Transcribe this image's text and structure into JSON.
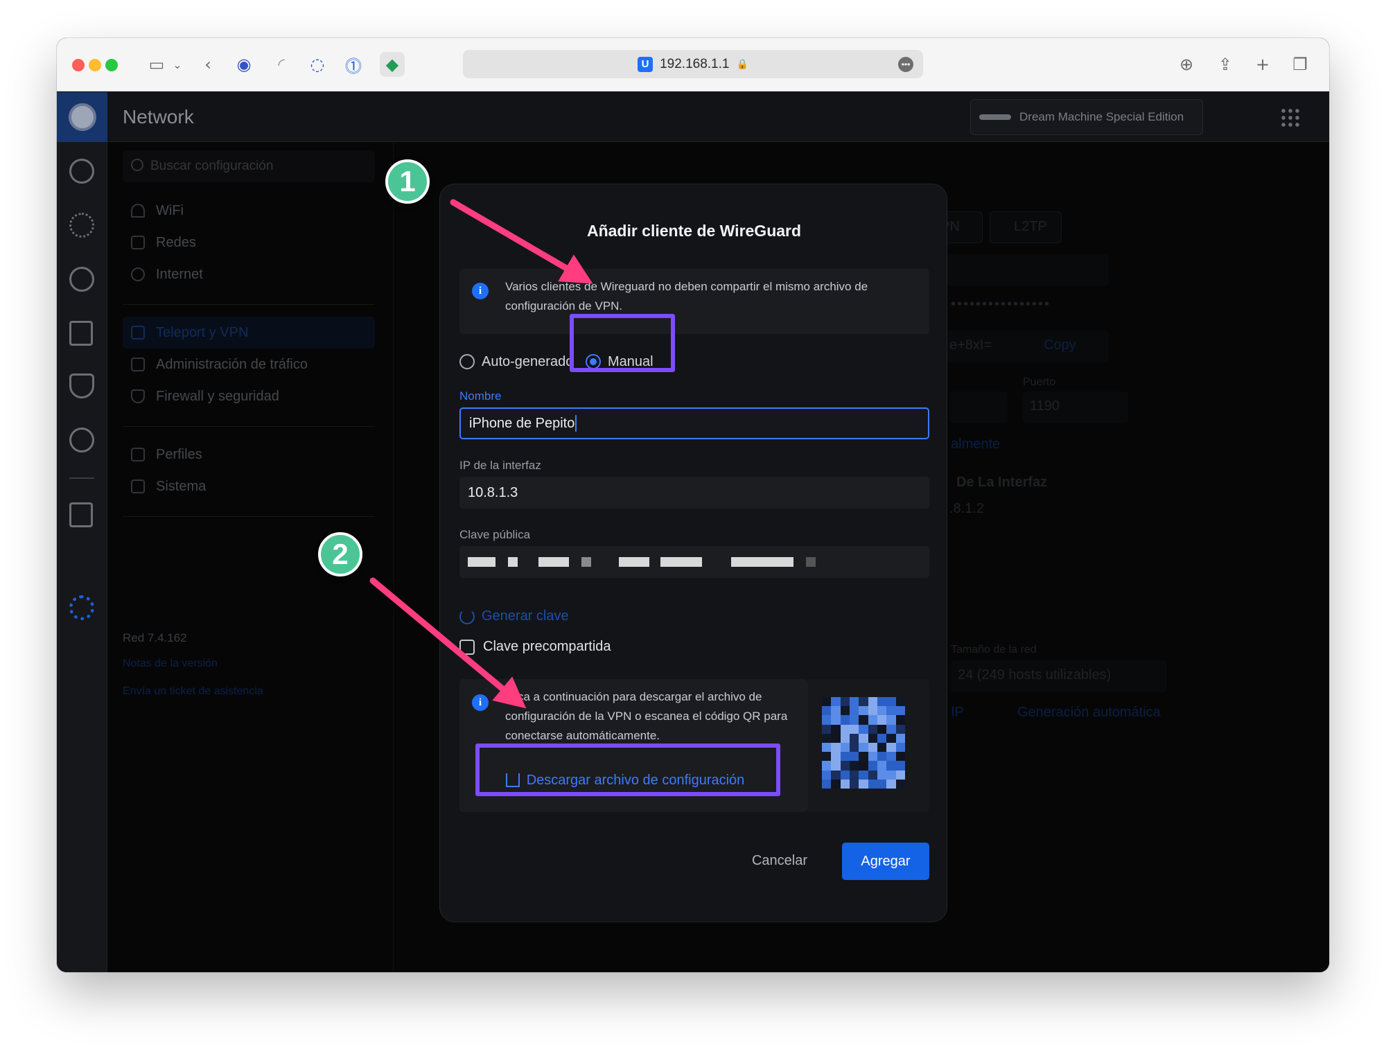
{
  "browser": {
    "url": "192.168.1.1",
    "favicon_letter": "U",
    "more_glyph": "•••"
  },
  "app": {
    "title": "Network",
    "device": "Dream Machine Special Edition"
  },
  "sidebar": {
    "search_placeholder": "Buscar configuración",
    "items": [
      {
        "label": "WiFi"
      },
      {
        "label": "Redes"
      },
      {
        "label": "Internet"
      },
      {
        "label": "Teleport y VPN"
      },
      {
        "label": "Administración de tráfico"
      },
      {
        "label": "Firewall y seguridad"
      },
      {
        "label": "Perfiles"
      },
      {
        "label": "Sistema"
      }
    ],
    "version": "Red 7.4.162",
    "release_notes": "Notas de la versión",
    "support_ticket": "Envía un ticket de asistencia"
  },
  "background": {
    "l2tp": "L2TP",
    "pn_fragment": "PN",
    "key_fragment": "e+8xI=",
    "copy": "Copy",
    "puerto_label": "Puerto",
    "puerto_value": "1190",
    "manual_fragment": "almente",
    "interface_heading": "De La Interfaz",
    "ip_fragment": ".8.1.2",
    "network_size_label": "Tamaño de la red",
    "network_size_value": "24 (249 hosts utilizables)",
    "ip_fragment2": "IP",
    "auto_generate": "Generación automática"
  },
  "modal": {
    "title": "Añadir cliente de WireGuard",
    "info_line1": "Varios clientes de Wireguard no deben compartir el mismo archivo de",
    "info_line2": "configuración de VPN.",
    "radio_auto": "Auto-generado",
    "radio_manual": "Manual",
    "name_label": "Nombre",
    "name_value": "iPhone de Pepito",
    "ip_label": "IP de la interfaz",
    "ip_value": "10.8.1.3",
    "pubkey_label": "Clave pública",
    "generate_key": "Generar clave",
    "preshared": "Clave precompartida",
    "download_info_line1": "Toca a continuación para descargar el archivo de",
    "download_info_line2": "configuración de la VPN o escanea el código QR para",
    "download_info_line3": "conectarse automáticamente.",
    "download_button": "Descargar archivo de configuración",
    "cancel": "Cancelar",
    "add": "Agregar"
  },
  "annotations": {
    "step1": "1",
    "step2": "2",
    "highlight_color": "#7c4dff",
    "arrow_color": "#ff3d7f",
    "badge_color": "#4cc596"
  },
  "colors": {
    "accent": "#1462e6",
    "link": "#3d7bff"
  }
}
